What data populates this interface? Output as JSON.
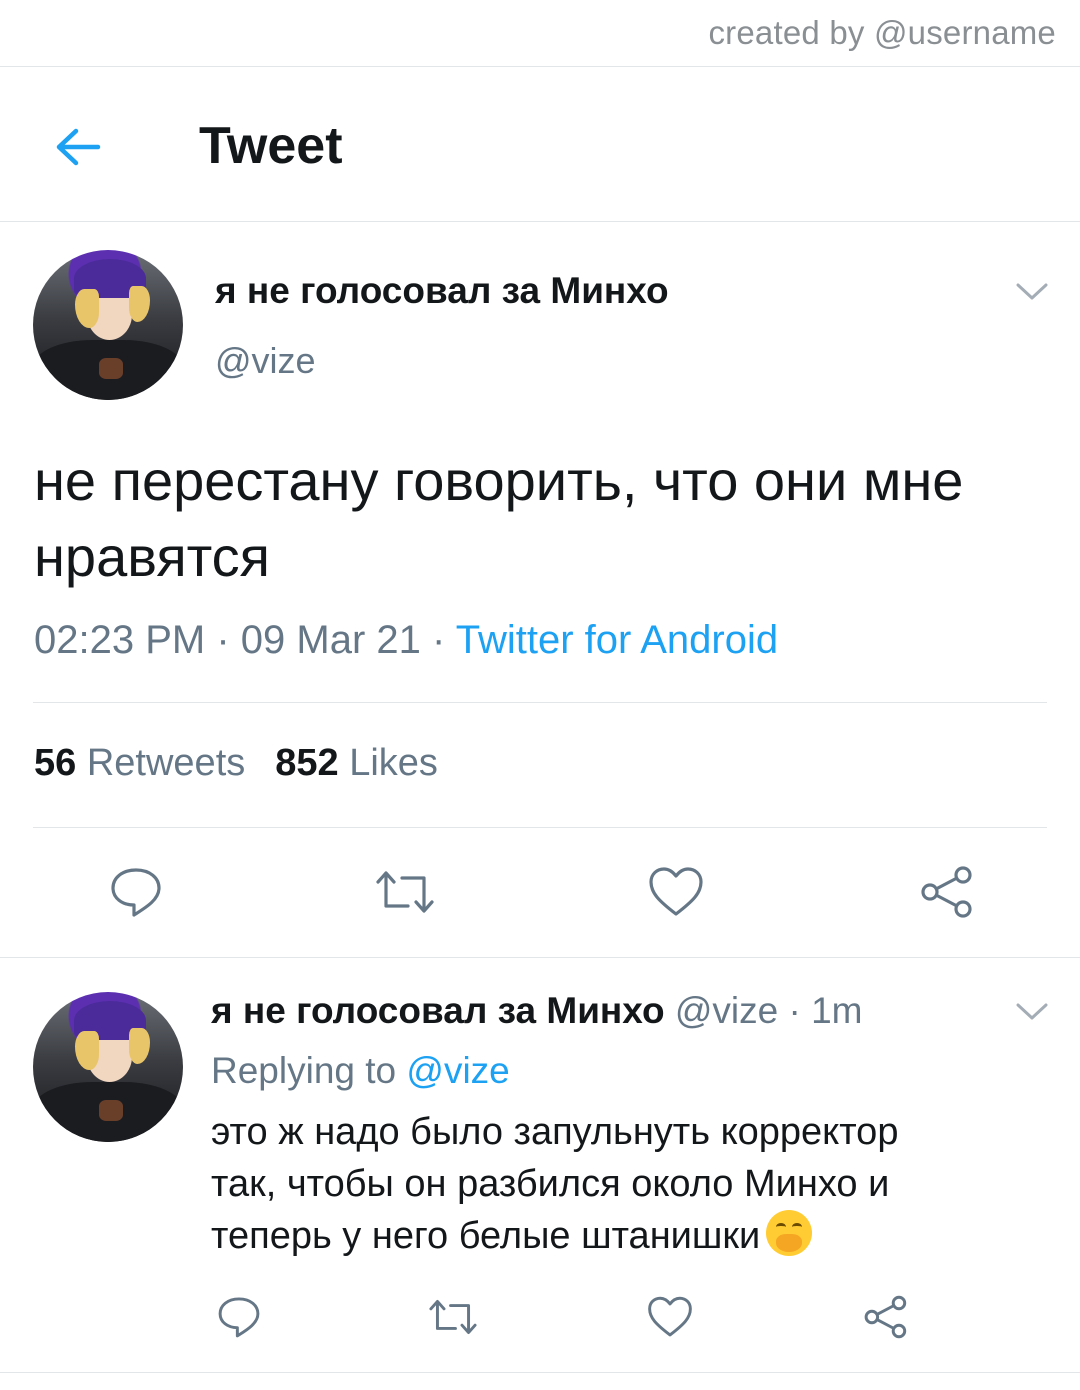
{
  "watermark": {
    "text": "created by @username"
  },
  "header": {
    "title": "Tweet",
    "back_icon": "arrow-left-icon",
    "accent": "#1da1f2"
  },
  "main_tweet": {
    "display_name": "я не голосовал за Минхо",
    "handle": "@vize",
    "text": "не перестану говорить, что они мне нравятся",
    "time": "02:23 PM",
    "date": "09 Mar 21",
    "separator": "·",
    "source": "Twitter for Android",
    "retweets_count": "56",
    "retweets_label": "Retweets",
    "likes_count": "852",
    "likes_label": "Likes",
    "actions": [
      "reply-icon",
      "retweet-icon",
      "like-icon",
      "share-icon"
    ]
  },
  "reply_tweet": {
    "display_name": "я не голосовал за Минхо",
    "handle": "@vize",
    "age": "· 1m",
    "replying_label": "Replying to",
    "replying_to": "@vize",
    "text": "это ж надо было запульнуть корректор\n так, чтобы он разбился около Минхо и\nтеперь у него белые штанишки",
    "emoji": "face-with-hand-over-mouth",
    "actions": [
      "reply-icon",
      "retweet-icon",
      "like-icon",
      "share-icon"
    ]
  }
}
